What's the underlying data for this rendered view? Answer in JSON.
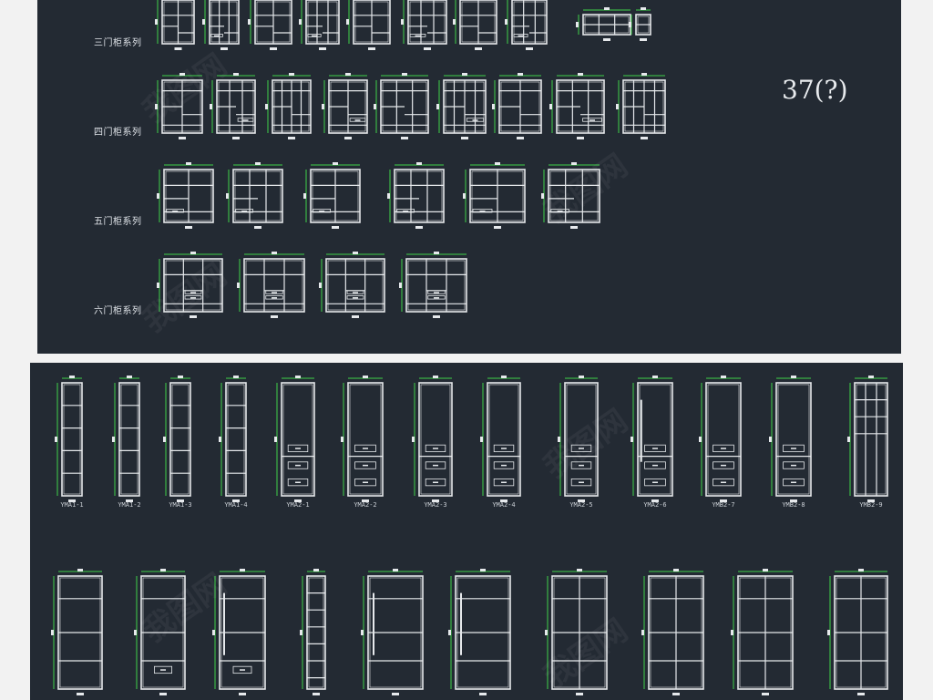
{
  "sections": {
    "top": {
      "rows": [
        {
          "label": "三门柜系列"
        },
        {
          "label": "四门柜系列"
        },
        {
          "label": "五门柜系列"
        },
        {
          "label": "六门柜系列"
        }
      ],
      "count_text": "37(?)"
    },
    "bottom": {
      "row1_codes": [
        "YMA1-1",
        "YMA1-2",
        "YMA1-3",
        "YMA1-4",
        "YMA2-1",
        "YMA2-2",
        "YMA2-3",
        "YMA2-4",
        "YMA2-5",
        "YMA2-6",
        "YMB2-7",
        "YMB2-8",
        "YMB2-9"
      ]
    }
  },
  "colors": {
    "background": "#f2f2f2",
    "panel": "#232a33",
    "line": "#e6e9ec",
    "dimension": "#3fd24a"
  },
  "watermark": "我图网"
}
